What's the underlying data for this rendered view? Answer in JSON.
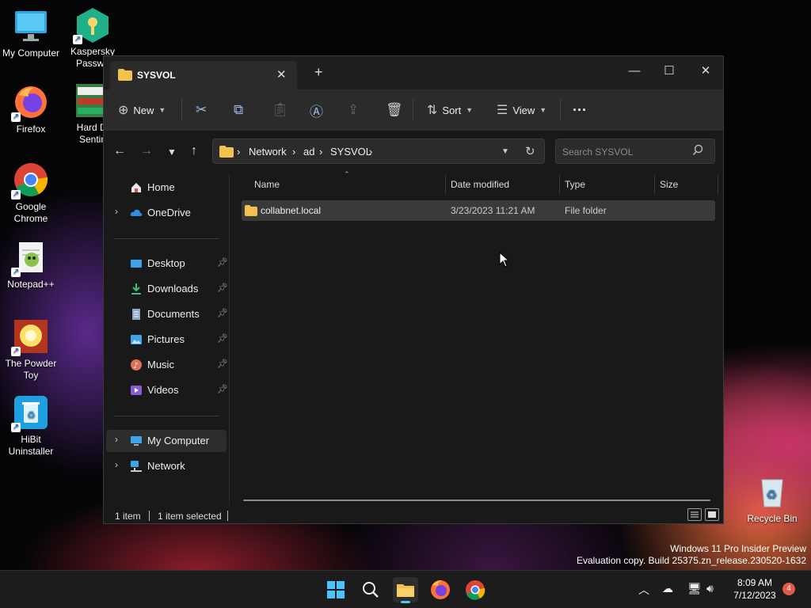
{
  "desktop": {
    "icons": [
      {
        "label": "My Computer"
      },
      {
        "label": "Kaspersky Passwo"
      },
      {
        "label": "Firefox"
      },
      {
        "label": "Hard Di Sentin"
      },
      {
        "label": "Google Chrome"
      },
      {
        "label": "Notepad++"
      },
      {
        "label": "The Powder Toy"
      },
      {
        "label": "HiBit Uninstaller"
      },
      {
        "label": "Recycle Bin"
      }
    ]
  },
  "explorer": {
    "tab_title": "SYSVOL",
    "toolbar": {
      "new_label": "New",
      "sort_label": "Sort",
      "view_label": "View",
      "more_label": "···"
    },
    "address": {
      "crumbs": [
        "Network",
        "ad",
        "SYSVOL"
      ],
      "separator": "›"
    },
    "search": {
      "placeholder": "Search SYSVOL"
    },
    "sidebar": {
      "items": [
        {
          "label": "Home"
        },
        {
          "label": "OneDrive"
        },
        {
          "label": "Desktop"
        },
        {
          "label": "Downloads"
        },
        {
          "label": "Documents"
        },
        {
          "label": "Pictures"
        },
        {
          "label": "Music"
        },
        {
          "label": "Videos"
        },
        {
          "label": "My Computer"
        },
        {
          "label": "Network"
        }
      ]
    },
    "columns": [
      "Name",
      "Date modified",
      "Type",
      "Size"
    ],
    "files": [
      {
        "name": "collabnet.local",
        "date_modified": "3/23/2023 11:21 AM",
        "type": "File folder",
        "size": ""
      }
    ],
    "status": {
      "item_count": "1 item",
      "selected": "1 item selected"
    }
  },
  "watermark": {
    "line1": "Windows 11 Pro Insider Preview",
    "line2": "Evaluation copy. Build 25375.zn_release.230520-1632"
  },
  "taskbar": {
    "time": "8:09 AM",
    "date": "7/12/2023",
    "notification_count": "4"
  },
  "colors": {
    "folder": "#f2c14e",
    "accent": "#4cc2ff",
    "window_bg": "#191919",
    "toolbar_bg": "#2b2b2b"
  }
}
